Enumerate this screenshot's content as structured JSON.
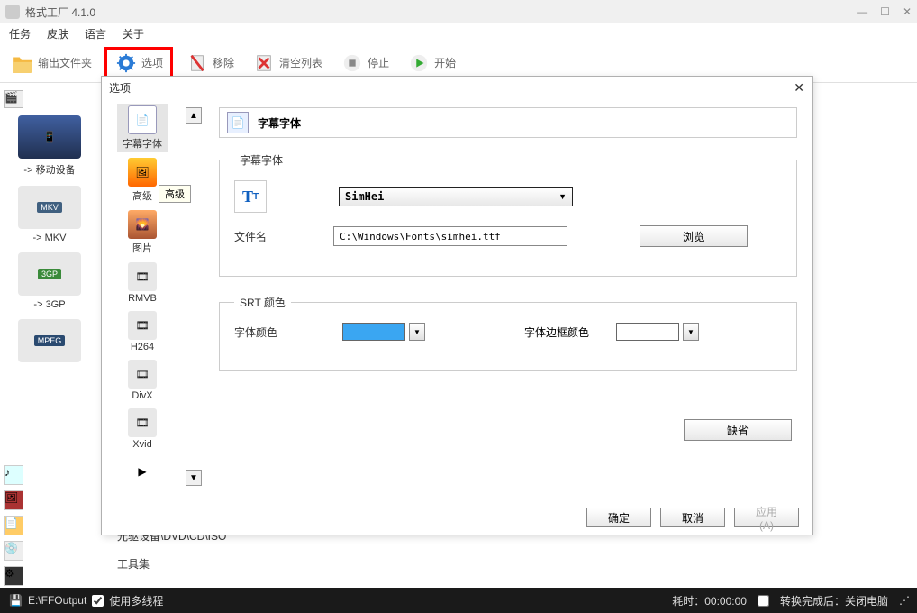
{
  "titlebar": {
    "app_title": "格式工厂 4.1.0"
  },
  "menubar": {
    "items": [
      "任务",
      "皮肤",
      "语言",
      "关于"
    ]
  },
  "toolbar": {
    "output_folder": "输出文件夹",
    "options": "选项",
    "remove": "移除",
    "clear_list": "清空列表",
    "stop": "停止",
    "start": "开始"
  },
  "left_cards": [
    {
      "label": "-> 移动设备"
    },
    {
      "label": "-> MKV"
    },
    {
      "label": "-> 3GP"
    },
    {
      "label": ""
    }
  ],
  "badge_mkv": "MKV",
  "badge_mpeg": "MPEG",
  "dialog": {
    "title": "选项",
    "close": "✕",
    "opt_items": [
      {
        "label": "字幕字体"
      },
      {
        "label": "高级"
      },
      {
        "tooltip": "高级"
      },
      {
        "label": "图片"
      },
      {
        "label": "RMVB"
      },
      {
        "label": "H264"
      },
      {
        "label": "DivX"
      },
      {
        "label": "Xvid"
      },
      {
        "label": ""
      }
    ],
    "section_header": "字幕字体",
    "group1": {
      "legend": "字幕字体",
      "font_label_selected": "SimHei",
      "file_label": "文件名",
      "file_value": "C:\\Windows\\Fonts\\simhei.ttf",
      "browse": "浏览"
    },
    "group2": {
      "legend": "SRT 颜色",
      "font_color_label": "字体颜色",
      "font_color": "#3aa6f2",
      "border_color_label": "字体边框颜色",
      "border_color": "#ffffff"
    },
    "default_btn": "缺省",
    "buttons": {
      "ok": "确定",
      "cancel": "取消",
      "apply": "应用 (A)"
    }
  },
  "bottom_nav": {
    "optical": "光驱设备\\DVD\\CD\\ISO",
    "tools": "工具集"
  },
  "statusbar": {
    "output_path": "E:\\FFOutput",
    "multithread": "使用多线程",
    "elapsed_label": "耗时：",
    "elapsed_value": "00:00:00",
    "after_label": "转换完成后：",
    "after_value": "关闭电脑"
  }
}
